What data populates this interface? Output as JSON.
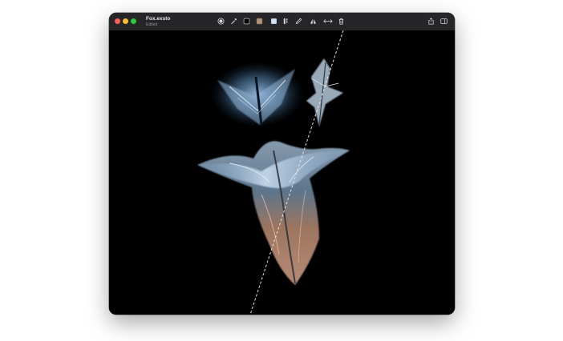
{
  "window": {
    "document_title": "Fox.exsto",
    "document_status": "Edited"
  },
  "toolbar": {
    "tools": [
      {
        "icon": "brush-tip-icon"
      },
      {
        "icon": "eyedropper-icon"
      },
      {
        "icon": "color-swatch-black-icon",
        "color": "#000000"
      },
      {
        "icon": "color-swatch-tan-icon",
        "color": "#b39277"
      },
      {
        "icon": "color-swatch-lightblue-icon",
        "color": "#cfe3f6"
      },
      {
        "icon": "brush-size-icon"
      },
      {
        "icon": "pen-tool-icon"
      },
      {
        "icon": "symmetry-icon"
      },
      {
        "icon": "resize-arrows-icon"
      },
      {
        "icon": "trash-icon"
      }
    ],
    "right_buttons": [
      {
        "icon": "share-icon"
      },
      {
        "icon": "sidebar-toggle-icon"
      }
    ]
  },
  "colors": {
    "canvas_background": "#000000",
    "titlebar": "#262628",
    "close": "#ff5f57",
    "minimize": "#febc2e",
    "maximize": "#28c840"
  }
}
